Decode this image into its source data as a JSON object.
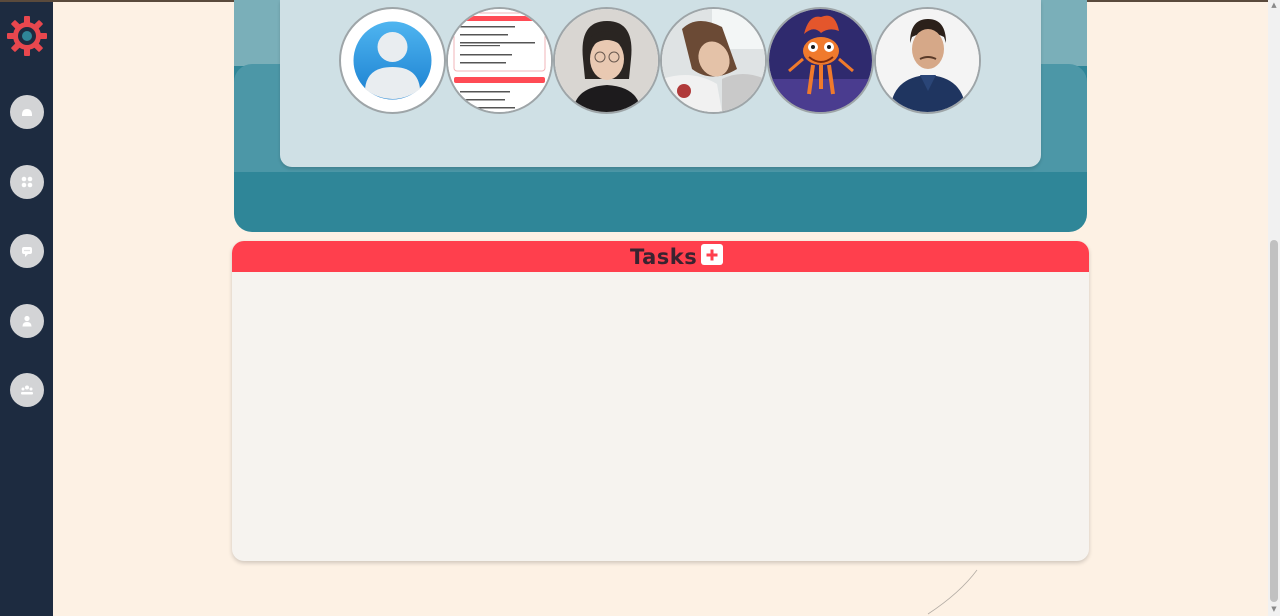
{
  "sidebar": {
    "logo_icon": "gear-logo-icon",
    "items": [
      {
        "name": "home",
        "icon": "home-icon"
      },
      {
        "name": "apps",
        "icon": "grid-icon"
      },
      {
        "name": "chat",
        "icon": "chat-icon"
      },
      {
        "name": "profile",
        "icon": "user-icon"
      },
      {
        "name": "team",
        "icon": "team-icon"
      }
    ]
  },
  "team": {
    "members": [
      {
        "kind": "default-avatar"
      },
      {
        "kind": "screenshot-avatar"
      },
      {
        "kind": "photo-avatar"
      },
      {
        "kind": "photo-avatar"
      },
      {
        "kind": "cartoon-avatar"
      },
      {
        "kind": "photo-avatar"
      }
    ]
  },
  "tasks": {
    "title": "Tasks",
    "add_icon": "plus-icon"
  },
  "colors": {
    "sidebar": "#1d2b40",
    "accent_red": "#ff3f4d",
    "teal": "#2f8698",
    "background": "#fdf1e4"
  }
}
